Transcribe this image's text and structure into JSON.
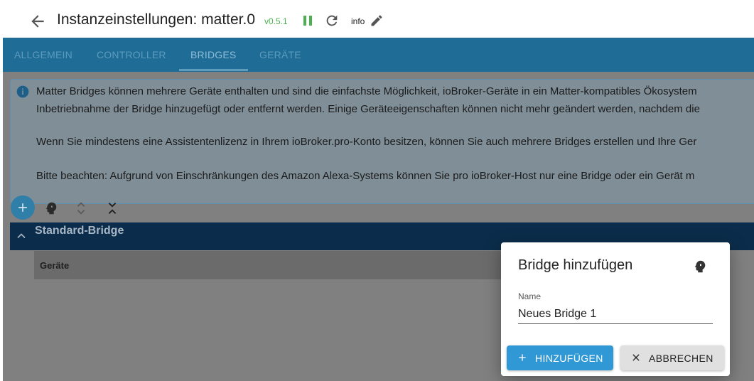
{
  "header": {
    "title": "Instanzeinstellungen: matter.0",
    "version": "v0.5.1",
    "info_label": "info"
  },
  "tabs": [
    {
      "label": "ALLGEMEIN"
    },
    {
      "label": "CONTROLLER"
    },
    {
      "label": "BRIDGES"
    },
    {
      "label": "GERÄTE"
    }
  ],
  "active_tab": "BRIDGES",
  "alert": {
    "line1": "Matter Bridges können mehrere Geräte enthalten und sind die einfachste Möglichkeit, ioBroker-Geräte in ein Matter-kompatibles Ökosystem",
    "line2": "Inbetriebnahme der Bridge hinzugefügt oder entfernt werden. Einige Geräteeigenschaften können nicht mehr geändert werden, nachdem die",
    "line3": "Wenn Sie mindestens eine Assistentenlizenz in Ihrem ioBroker.pro-Konto besitzen, können Sie auch mehrere Bridges erstellen und Ihre Ger",
    "line4": "Bitte beachten: Aufgrund von Einschränkungen des Amazon Alexa-Systems können Sie pro ioBroker-Host nur eine Bridge oder ein Gerät m"
  },
  "bridge": {
    "title": "Standard-Bridge",
    "devices_column": "Geräte"
  },
  "dialog": {
    "title": "Bridge hinzufügen",
    "name_label": "Name",
    "name_value": "Neues Bridge 1",
    "add_label": "HINZUFÜGEN",
    "cancel_label": "ABBRECHEN"
  },
  "colors": {
    "tab_bar": "#1f6c97",
    "bridge_bar": "#0b2d4b",
    "primary_button": "#2f98d5",
    "version": "#4caf50"
  }
}
